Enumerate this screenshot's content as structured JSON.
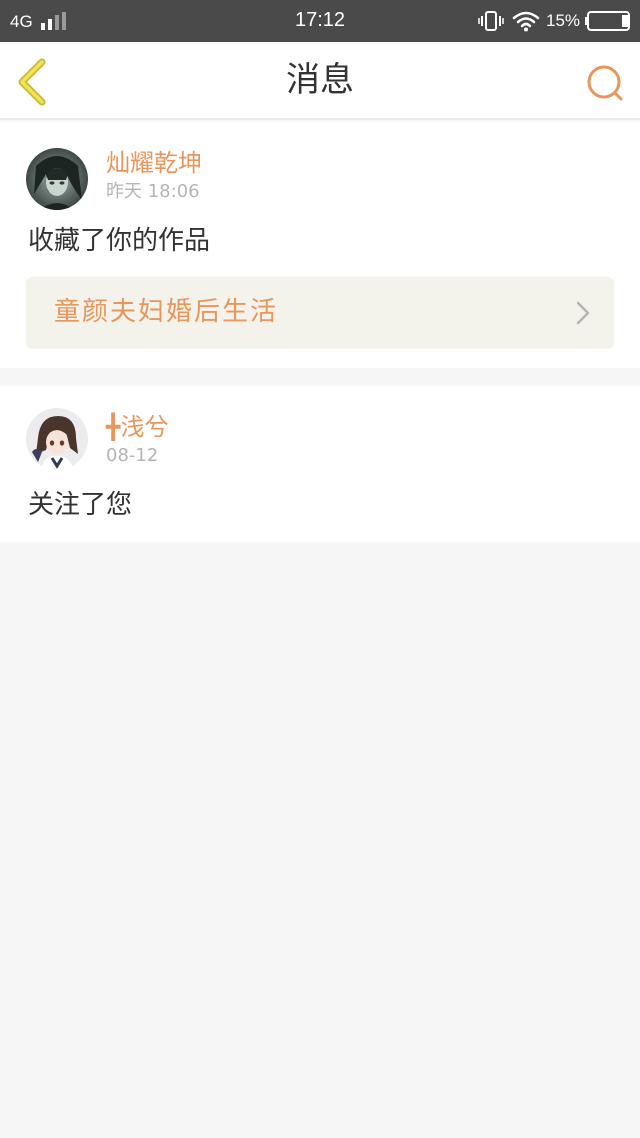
{
  "status_bar": {
    "network": "4G",
    "time": "17:12",
    "battery_percent": "15%",
    "battery_level": 0.15
  },
  "nav": {
    "title": "消息",
    "accent_color": "#e8965b"
  },
  "messages": [
    {
      "username": "灿耀乾坤",
      "timestamp": "昨天 18:06",
      "action": "收藏了你的作品",
      "work_title": "童颜夫妇婚后生活"
    },
    {
      "username": "╋浅兮",
      "timestamp": "08-12",
      "action": "关注了您"
    }
  ]
}
